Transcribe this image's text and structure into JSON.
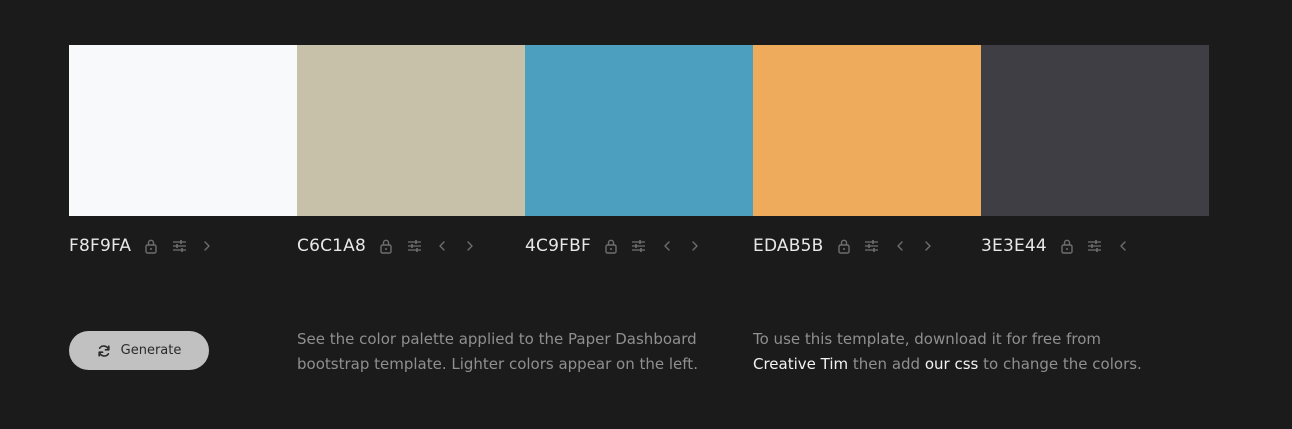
{
  "palette": {
    "swatches": [
      {
        "hex": "F8F9FA",
        "color": "#F8F9FA",
        "move_left": false,
        "move_right": true
      },
      {
        "hex": "C6C1A8",
        "color": "#C6C1A8",
        "move_left": true,
        "move_right": true
      },
      {
        "hex": "4C9FBF",
        "color": "#4C9FBF",
        "move_left": true,
        "move_right": true
      },
      {
        "hex": "EDAB5B",
        "color": "#EDAB5B",
        "move_left": true,
        "move_right": true
      },
      {
        "hex": "3E3E44",
        "color": "#3E3E44",
        "move_left": true,
        "move_right": false
      }
    ],
    "icons": {
      "lock": "lock-icon",
      "adjust": "sliders-icon",
      "left": "chevron-left-icon",
      "right": "chevron-right-icon"
    }
  },
  "controls": {
    "generate_label": "Generate",
    "generate_icon": "refresh-icon"
  },
  "description": {
    "line1": "See the color palette applied to the Paper Dashboard",
    "line2": "bootstrap template. Lighter colors appear on the left."
  },
  "usage": {
    "prefix": "To use this template, download it for free from",
    "link1": "Creative Tim",
    "middle": "then add",
    "link2": "our css",
    "suffix": "to change the colors."
  },
  "colors": {
    "background": "#1B1B1B",
    "hex_text": "#E8E8E8",
    "icon": "#6E6E6E",
    "muted_text": "#8F8F8F",
    "link_text": "#F2F2F2",
    "button_bg": "#C1C1C1"
  }
}
